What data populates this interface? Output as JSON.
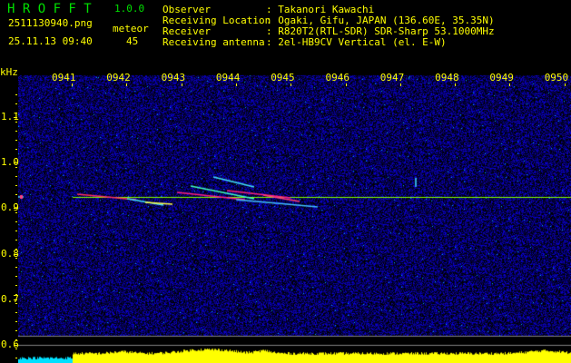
{
  "app": {
    "name": "H R O F F T",
    "version": "1.0.0"
  },
  "file": {
    "name": "2511130940.png",
    "datetime": "25.11.13 09:40"
  },
  "meteor": {
    "label": "meteor",
    "count": "45"
  },
  "info": [
    {
      "label": "Observer",
      "value": ": Takanori Kawachi"
    },
    {
      "label": "Receiving Location",
      "value": ": Ogaki, Gifu, JAPAN (136.60E, 35.35N)"
    },
    {
      "label": "Receiver",
      "value": ": R820T2(RTL-SDR) SDR-Sharp 53.1000MHz"
    },
    {
      "label": "Receiving antenna",
      "value": ": 2el-HB9CV Vertical (el. E-W)"
    }
  ],
  "axis": {
    "y_unit": "kHz",
    "y_ticks": [
      "1.1",
      "1.0",
      "0.9",
      "0.8",
      "0.7",
      "0.6"
    ],
    "x_ticks": [
      "0941",
      "0942",
      "0943",
      "0944",
      "0945",
      "0946",
      "0947",
      "0948",
      "0949",
      "0950"
    ]
  },
  "colors": {
    "text": "#ffff00",
    "title": "#00e000",
    "background": "#000000",
    "noise": "#1010a0",
    "carrier": "#80ff00",
    "histogram": "#ffff00",
    "histogram_low": "#00e0ff"
  }
}
